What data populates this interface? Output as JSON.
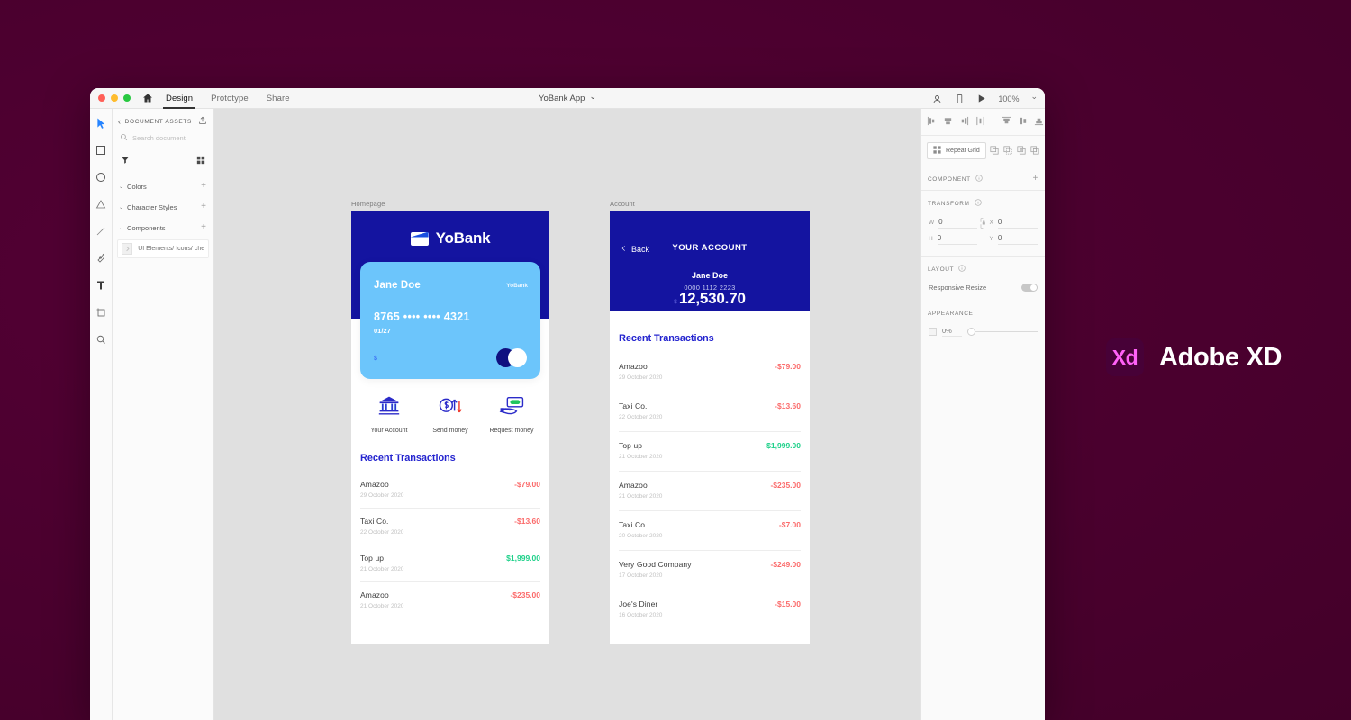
{
  "app": {
    "titlebar": {
      "home_icon": "home-icon",
      "tabs": [
        {
          "label": "Design",
          "active": true
        },
        {
          "label": "Prototype",
          "active": false
        },
        {
          "label": "Share",
          "active": false
        }
      ],
      "document_name": "YoBank App",
      "document_caret": "⌄",
      "right_icons": [
        "coedit-icon",
        "device-preview-icon",
        "play-icon"
      ],
      "zoom_level": "100%",
      "zoom_caret": "⌄"
    },
    "toolrail": {
      "tools": [
        "select-tool-icon",
        "rectangle-tool-icon",
        "ellipse-tool-icon",
        "polygon-tool-icon",
        "line-tool-icon",
        "pen-tool-icon",
        "text-tool-icon",
        "artboard-tool-icon",
        "zoom-tool-icon"
      ]
    },
    "assets_panel": {
      "header_label": "DOCUMENT ASSETS",
      "back_caret": "‹",
      "export_icon": "export-icon",
      "search_placeholder": "Search document",
      "search_value": "",
      "search_icon": "search-icon",
      "search_caret": "⌄",
      "filter_icon": "filter-icon",
      "grid_icon": "grid-view-icon",
      "sections": [
        {
          "label": "Colors",
          "caret": "⌄",
          "add": "+"
        },
        {
          "label": "Character Styles",
          "caret": "⌄",
          "add": "+"
        },
        {
          "label": "Components",
          "caret": "⌄",
          "add": "+"
        }
      ],
      "component_item": {
        "name": "UI Elements/ Icons/ che...",
        "thumb_icon": "chevron-right-icon"
      }
    },
    "props_panel": {
      "align_left_group": [
        "align-left-icon",
        "align-center-h-icon",
        "align-right-icon",
        "distribute-h-icon"
      ],
      "align_right_group": [
        "align-top-icon",
        "align-middle-v-icon",
        "align-bottom-icon",
        "distribute-v-icon"
      ],
      "repeat_grid_label": "Repeat Grid",
      "repeat_grid_icon": "repeat-grid-icon",
      "boolean_icons": [
        "boolean-add-icon",
        "boolean-subtract-icon",
        "boolean-intersect-icon",
        "boolean-exclude-icon"
      ],
      "component_section": {
        "label": "COMPONENT",
        "info_icon": "info-icon",
        "add": "+"
      },
      "transform_section": {
        "label": "TRANSFORM",
        "info_icon": "info-icon",
        "fields": [
          {
            "key": "W",
            "value": "0"
          },
          {
            "key": "X",
            "value": "0"
          },
          {
            "key": "H",
            "value": "0"
          },
          {
            "key": "Y",
            "value": "0"
          }
        ],
        "lock_icon": "lock-aspect-icon"
      },
      "layout_section": {
        "label": "LAYOUT",
        "info_icon": "info-icon",
        "responsive_resize_label": "Responsive Resize",
        "responsive_resize_on": true
      },
      "appearance_section": {
        "label": "APPEARANCE",
        "opacity_icon": "opacity-icon",
        "opacity_value": "0%"
      }
    }
  },
  "artboards": [
    {
      "name": "Homepage",
      "brand": {
        "name": "YoBank",
        "icon": "wallet-icon"
      },
      "card": {
        "holder": "Jane Doe",
        "brand": "YoBank",
        "number": "8765 •••• •••• 4321",
        "expiry": "01/27",
        "currency": "$",
        "logo": "mastercard-icon"
      },
      "actions": [
        {
          "label": "Your Account",
          "icon": "bank-icon"
        },
        {
          "label": "Send money",
          "icon": "send-money-icon"
        },
        {
          "label": "Request money",
          "icon": "request-money-icon"
        }
      ],
      "transactions_title": "Recent Transactions",
      "transactions": [
        {
          "name": "Amazoo",
          "date": "29 October 2020",
          "amount": "-$79.00",
          "kind": "neg"
        },
        {
          "name": "Taxi Co.",
          "date": "22 October 2020",
          "amount": "-$13.60",
          "kind": "neg"
        },
        {
          "name": "Top up",
          "date": "21 October 2020",
          "amount": "$1,999.00",
          "kind": "pos"
        },
        {
          "name": "Amazoo",
          "date": "21 October 2020",
          "amount": "-$235.00",
          "kind": "neg"
        }
      ]
    },
    {
      "name": "Account",
      "back_label": "Back",
      "back_icon": "chevron-left-icon",
      "title": "YOUR ACCOUNT",
      "holder": "Jane Doe",
      "account_number": "0000 1112 2223",
      "currency": "$",
      "balance": "12,530.70",
      "transactions_title": "Recent Transactions",
      "transactions": [
        {
          "name": "Amazoo",
          "date": "29 October 2020",
          "amount": "-$79.00",
          "kind": "neg"
        },
        {
          "name": "Taxi Co.",
          "date": "22 October 2020",
          "amount": "-$13.60",
          "kind": "neg"
        },
        {
          "name": "Top up",
          "date": "21 October 2020",
          "amount": "$1,999.00",
          "kind": "pos"
        },
        {
          "name": "Amazoo",
          "date": "21 October 2020",
          "amount": "-$235.00",
          "kind": "neg"
        },
        {
          "name": "Taxi Co.",
          "date": "20 October 2020",
          "amount": "-$7.00",
          "kind": "neg"
        },
        {
          "name": "Very Good Company",
          "date": "17 October 2020",
          "amount": "-$249.00",
          "kind": "neg"
        },
        {
          "name": "Joe's Diner",
          "date": "16 October 2020",
          "amount": "-$15.00",
          "kind": "neg"
        }
      ]
    }
  ],
  "branding": {
    "mark_text": "Xd",
    "wordmark": "Adobe XD",
    "mark_color": "#ff61f6",
    "background_color": "#4d0033"
  }
}
